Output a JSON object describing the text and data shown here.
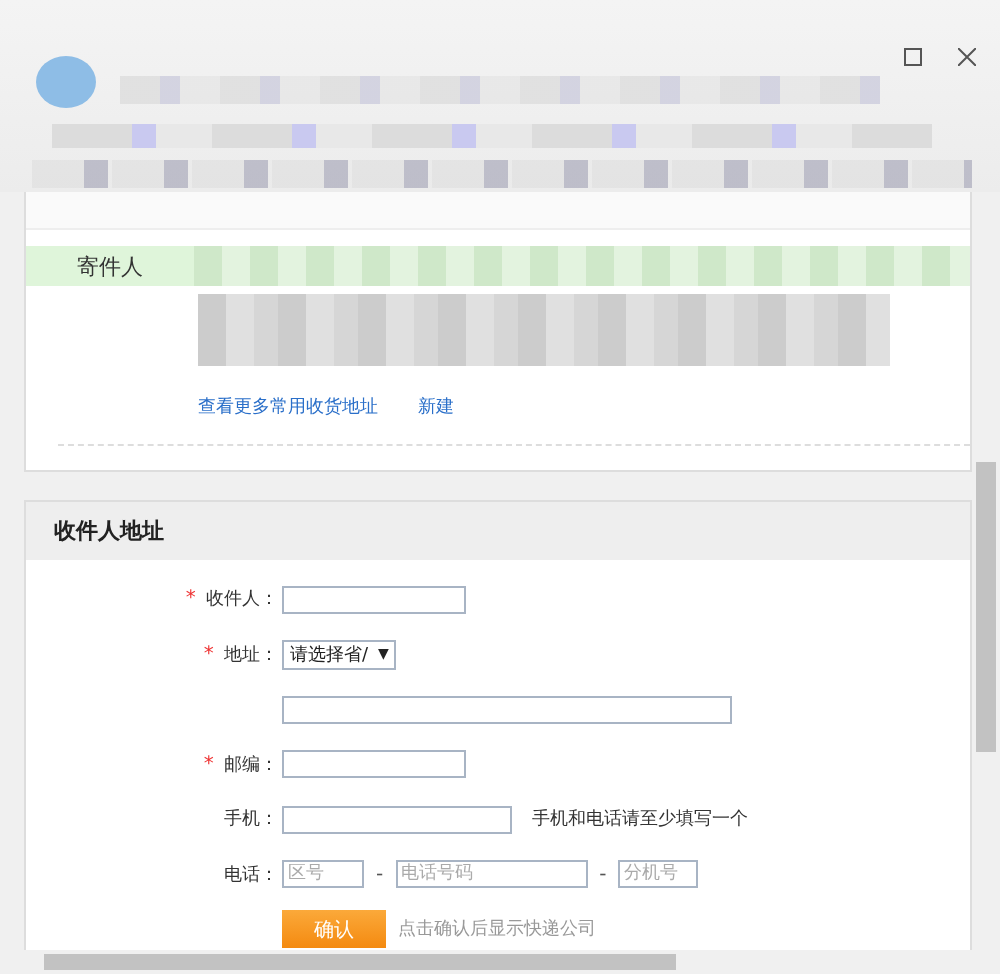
{
  "sender_card": {
    "label": "寄件人",
    "links": [
      {
        "text": "查看更多常用收货地址"
      },
      {
        "text": "新建"
      }
    ]
  },
  "recipient_card": {
    "title": "收件人地址",
    "fields": [
      {
        "kind": "name",
        "marker": "*",
        "label": "收件人："
      },
      {
        "kind": "select",
        "marker": "*",
        "label": "地址：",
        "value": "请选择省/",
        "arrow": "▼"
      },
      {
        "kind": "address"
      },
      {
        "kind": "postcode",
        "marker": "*",
        "label": "邮编："
      },
      {
        "kind": "mobile",
        "label": "手机：",
        "hint": "手机和电话请至少填写一个"
      },
      {
        "kind": "phone",
        "label": "电话：",
        "parts": [
          {
            "kind": "input",
            "placeholder": "区号"
          },
          {
            "kind": "separator",
            "text": "-"
          },
          {
            "kind": "input",
            "placeholder": "电话号码"
          },
          {
            "kind": "separator",
            "text": "-"
          },
          {
            "kind": "input",
            "placeholder": "分机号"
          }
        ]
      }
    ],
    "submit": {
      "label": "确认",
      "note": "点击确认后显示快递公司"
    }
  }
}
